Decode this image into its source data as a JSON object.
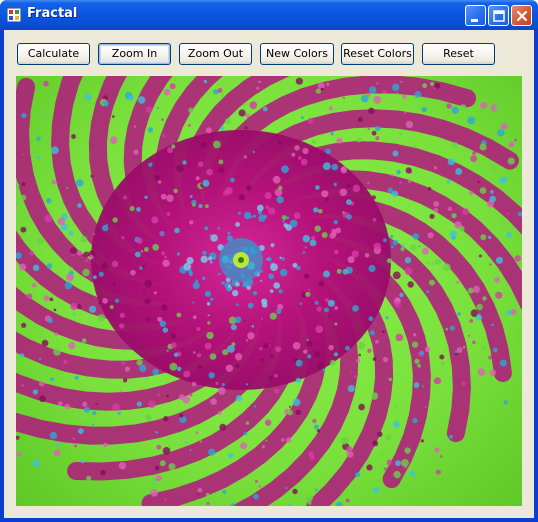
{
  "window": {
    "title": "Fractal",
    "icon": "fractal-app-icon",
    "controls": [
      "minimize-icon",
      "maximize-icon",
      "close-icon"
    ]
  },
  "toolbar": {
    "calculate_label": "Calculate",
    "zoom_in_label": "Zoom In",
    "zoom_out_label": "Zoom Out",
    "new_colors_label": "New Colors",
    "reset_colors_label": "Reset Colors",
    "reset_label": "Reset"
  },
  "colors": {
    "titlebar": "#0a55de",
    "client_bg": "#ece9d8",
    "fractal_exterior": "#7fe040",
    "fractal_body": "#c0157e",
    "fractal_detail": "#2aa8d8"
  }
}
